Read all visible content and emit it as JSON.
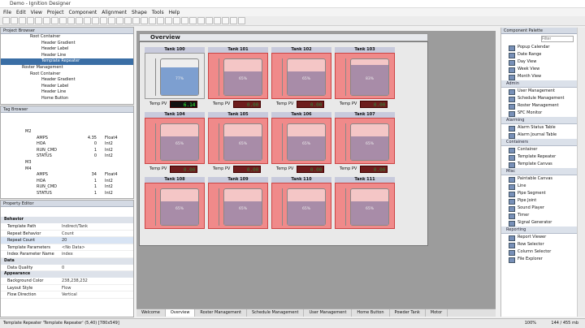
{
  "window": {
    "title": "Demo - Ignition Designer"
  },
  "menu": [
    "File",
    "Edit",
    "View",
    "Project",
    "Component",
    "Alignment",
    "Shape",
    "Tools",
    "Help"
  ],
  "project_browser": {
    "title": "Project Browser",
    "items": [
      "Root Container",
      "Header Gradient",
      "Header Label",
      "Header Line",
      "Template Repeater",
      "Roster Management",
      "Root Container",
      "Header Gradient",
      "Header Label",
      "Header Line",
      "Home Button"
    ]
  },
  "tag_browser": {
    "title": "Tag Browser",
    "rows": [
      [
        "M2",
        "",
        ""
      ],
      [
        "AMPS",
        "4.35",
        "Float4"
      ],
      [
        "HOA",
        "0",
        "Int2"
      ],
      [
        "RUN_CMD",
        "1",
        "Int2"
      ],
      [
        "STATUS",
        "0",
        "Int2"
      ],
      [
        "M3",
        "",
        ""
      ],
      [
        "M4",
        "",
        ""
      ],
      [
        "AMPS",
        "34",
        "Float4"
      ],
      [
        "HOA",
        "1",
        "Int2"
      ],
      [
        "RUN_CMD",
        "1",
        "Int2"
      ],
      [
        "STATUS",
        "1",
        "Int2"
      ]
    ]
  },
  "property_editor": {
    "title": "Property Editor",
    "groups": [
      {
        "name": "Behavior",
        "props": [
          [
            "Template Path",
            "Indirect/Tank"
          ],
          [
            "Repeat Behavior",
            "Count"
          ],
          [
            "Repeat Count",
            "20"
          ],
          [
            "Template Parameters",
            "<No Data>"
          ],
          [
            "Index Parameter Name",
            "index"
          ]
        ]
      },
      {
        "name": "Data",
        "props": [
          [
            "Data Quality",
            "0"
          ]
        ]
      },
      {
        "name": "Appearance",
        "props": [
          [
            "Background Color",
            "238,238,232"
          ],
          [
            "Layout Style",
            "Flow"
          ],
          [
            "Flow Direction",
            "Vertical"
          ]
        ]
      }
    ]
  },
  "overview": {
    "title": "Overview"
  },
  "tanks": [
    {
      "name": "Tank 100",
      "level": "77%",
      "lcd": "6.14",
      "blue": true
    },
    {
      "name": "Tank 101",
      "level": "65%",
      "lcd": "0.00"
    },
    {
      "name": "Tank 102",
      "level": "65%",
      "lcd": "0.00"
    },
    {
      "name": "Tank 103",
      "level": "83%",
      "lcd": "0.00"
    },
    {
      "name": "Tank 104",
      "level": "65%",
      "lcd": "0.00"
    },
    {
      "name": "Tank 105",
      "level": "65%",
      "lcd": "0.00"
    },
    {
      "name": "Tank 106",
      "level": "65%",
      "lcd": "0.00"
    },
    {
      "name": "Tank 107",
      "level": "65%",
      "lcd": "0.00"
    },
    {
      "name": "Tank 108",
      "level": "65%"
    },
    {
      "name": "Tank 109",
      "level": "65%"
    },
    {
      "name": "Tank 110",
      "level": "65%"
    },
    {
      "name": "Tank 111",
      "level": "65%"
    }
  ],
  "temp_pv_label": "Temp PV",
  "palette": {
    "title": "Component Palette",
    "search_placeholder": "Filter",
    "sections": [
      {
        "name": "",
        "items": [
          "Popup Calendar",
          "Date Range",
          "Day View",
          "Week View",
          "Month View"
        ]
      },
      {
        "name": "Admin",
        "items": [
          "User Management",
          "Schedule Management",
          "Roster Management",
          "SFC Monitor"
        ]
      },
      {
        "name": "Alarming",
        "items": [
          "Alarm Status Table",
          "Alarm Journal Table"
        ]
      },
      {
        "name": "Containers",
        "items": [
          "Container",
          "Template Repeater",
          "Template Canvas"
        ]
      },
      {
        "name": "Misc",
        "items": [
          "Paintable Canvas",
          "Line",
          "Pipe Segment",
          "Pipe Joint",
          "Sound Player",
          "Timer",
          "Signal Generator"
        ]
      },
      {
        "name": "Reporting",
        "items": [
          "Report Viewer",
          "Row Selector",
          "Column Selector",
          "File Explorer"
        ]
      }
    ]
  },
  "tabs": [
    "Welcome",
    "Overview",
    "Roster Management",
    "Schedule Management",
    "User Management",
    "Home Button",
    "Powder Tank",
    "Motor"
  ],
  "status": {
    "text": "Template Repeater 'Template Repeater' (5,40) [780x549]",
    "zoom": "100%",
    "memory": "144 / 455 mb"
  }
}
